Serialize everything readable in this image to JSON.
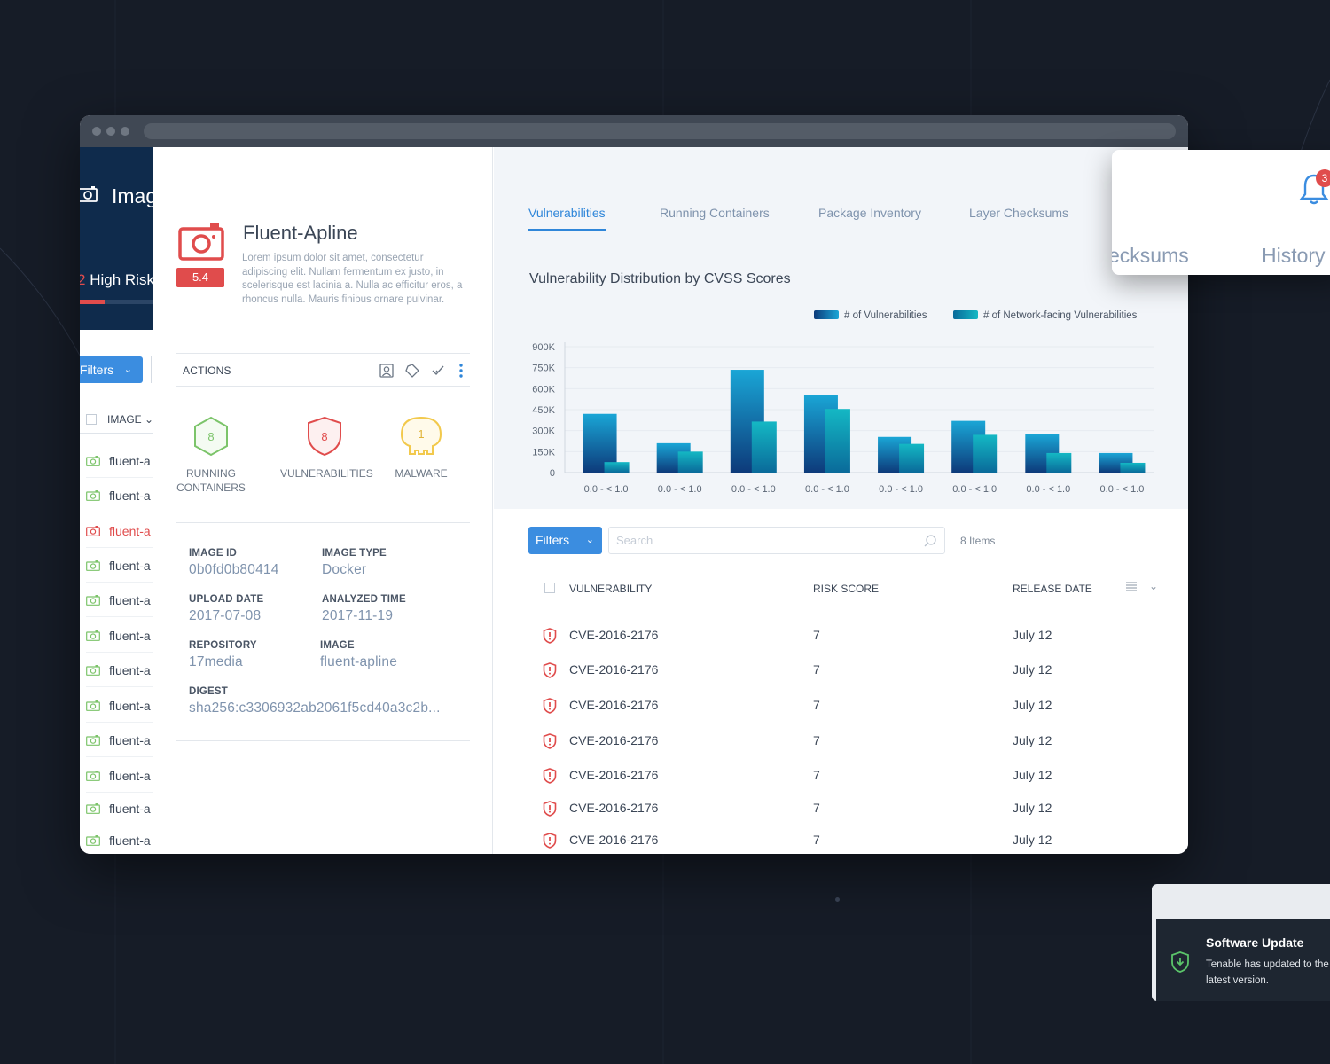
{
  "left_panel": {
    "title": "Imag",
    "risk_count": "2",
    "risk_label": "High Risk",
    "risk_progress": 0.34,
    "filters_label": "Filters",
    "column_header": "IMAGE",
    "rows": [
      {
        "label": "fluent-a",
        "status": "ok"
      },
      {
        "label": "fluent-a",
        "status": "ok"
      },
      {
        "label": "fluent-a",
        "status": "danger"
      },
      {
        "label": "fluent-a",
        "status": "ok"
      },
      {
        "label": "fluent-a",
        "status": "ok"
      },
      {
        "label": "fluent-a",
        "status": "ok"
      },
      {
        "label": "fluent-a",
        "status": "ok"
      },
      {
        "label": "fluent-a",
        "status": "ok"
      },
      {
        "label": "fluent-a",
        "status": "ok"
      },
      {
        "label": "fluent-a",
        "status": "ok"
      },
      {
        "label": "fluent-a",
        "status": "ok"
      },
      {
        "label": "fluent-a",
        "status": "ok"
      }
    ]
  },
  "detail": {
    "name": "Fluent-Apline",
    "score": "5.4",
    "description": "Lorem ipsum dolor sit amet, consectetur adipiscing elit. Nullam fermentum ex justo, in scelerisque est lacinia a. Nulla ac efficitur eros, a rhoncus nulla. Mauris finibus ornare pulvinar.",
    "actions_label": "ACTIONS",
    "stats": {
      "running": {
        "value": "8",
        "label_line1": "RUNNING",
        "label_line2": "CONTAINERS"
      },
      "vulnerabilities": {
        "value": "8",
        "label": "VULNERABILITIES"
      },
      "malware": {
        "value": "1",
        "label": "MALWARE"
      }
    },
    "meta": {
      "image_id": {
        "key": "IMAGE ID",
        "value": "0b0fd0b80414"
      },
      "image_type": {
        "key": "IMAGE TYPE",
        "value": "Docker"
      },
      "upload_date": {
        "key": "UPLOAD DATE",
        "value": "2017-07-08"
      },
      "analyzed_time": {
        "key": "ANALYZED TIME",
        "value": "2017-11-19"
      },
      "repository": {
        "key": "REPOSITORY",
        "value": "17media"
      },
      "image": {
        "key": "IMAGE",
        "value": "fluent-apline"
      },
      "digest": {
        "key": "DIGEST",
        "value": "sha256:c3306932ab2061f5cd40a3c2b..."
      }
    }
  },
  "tabs": [
    {
      "label": "Vulnerabilities",
      "active": true
    },
    {
      "label": "Running Containers",
      "active": false
    },
    {
      "label": "Package Inventory",
      "active": false
    },
    {
      "label": "Layer Checksums",
      "active": false
    }
  ],
  "chart_data": {
    "type": "bar",
    "title": "Vulnerability Distribution by CVSS Scores",
    "categories": [
      "0.0 - < 1.0",
      "0.0 - < 1.0",
      "0.0 - < 1.0",
      "0.0 - < 1.0",
      "0.0 - < 1.0",
      "0.0 - < 1.0",
      "0.0 - < 1.0",
      "0.0 - < 1.0"
    ],
    "series": [
      {
        "name": "# of Vulnerabilities",
        "values": [
          420000,
          210000,
          735000,
          555000,
          255000,
          370000,
          275000,
          140000
        ]
      },
      {
        "name": "# of Network-facing Vulnerabilities",
        "values": [
          75000,
          150000,
          365000,
          455000,
          205000,
          270000,
          140000,
          70000
        ]
      }
    ],
    "yticks": [
      "0",
      "150K",
      "300K",
      "450K",
      "600K",
      "750K",
      "900K"
    ],
    "ylim": [
      0,
      900000
    ],
    "grid": true,
    "legend": "top-right",
    "colors": {
      "series1_top": "#1aa6d6",
      "series1_bottom": "#0d3a7a",
      "series2_top": "#14b8c4",
      "series2_bottom": "#0a6a9a"
    }
  },
  "table": {
    "filters_label": "Filters",
    "search_placeholder": "Search",
    "count": "8 Items",
    "columns": {
      "vulnerability": "VULNERABILITY",
      "risk": "RISK SCORE",
      "release": "RELEASE DATE"
    },
    "rows": [
      {
        "id": "CVE-2016-2176",
        "risk": "7",
        "date": "July 12"
      },
      {
        "id": "CVE-2016-2176",
        "risk": "7",
        "date": "July 12"
      },
      {
        "id": "CVE-2016-2176",
        "risk": "7",
        "date": "July 12"
      },
      {
        "id": "CVE-2016-2176",
        "risk": "7",
        "date": "July 12"
      },
      {
        "id": "CVE-2016-2176",
        "risk": "7",
        "date": "July 12"
      },
      {
        "id": "CVE-2016-2176",
        "risk": "7",
        "date": "July 12"
      },
      {
        "id": "CVE-2016-2176",
        "risk": "7",
        "date": "July 12"
      }
    ]
  },
  "history_card": {
    "tab_partial": "ecksums",
    "tab_history": "History",
    "badge": "3"
  },
  "toast": {
    "title": "Software Update",
    "message": "Tenable has updated to the latest version."
  },
  "colors": {
    "accent": "#2f86d9",
    "danger": "#e04c4c",
    "success": "#7cc46a",
    "warning": "#f2c94c",
    "navy": "#0f2b4c"
  }
}
